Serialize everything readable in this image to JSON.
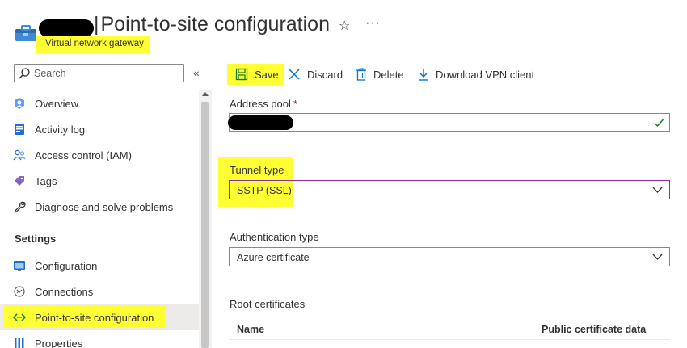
{
  "header": {
    "title": "Point-to-site configuration",
    "subtitle": "Virtual network gateway",
    "favorite_icon": "star-icon",
    "more_icon": "more-icon"
  },
  "sidebar": {
    "search_placeholder": "Search",
    "collapse_glyph": "«",
    "items_top": [
      {
        "label": "Overview",
        "icon": "overview-icon"
      },
      {
        "label": "Activity log",
        "icon": "activity-log-icon"
      },
      {
        "label": "Access control (IAM)",
        "icon": "iam-icon"
      },
      {
        "label": "Tags",
        "icon": "tag-icon"
      },
      {
        "label": "Diagnose and solve problems",
        "icon": "wrench-icon"
      }
    ],
    "section_settings": "Settings",
    "items_settings": [
      {
        "label": "Configuration",
        "icon": "configuration-icon"
      },
      {
        "label": "Connections",
        "icon": "connections-icon"
      },
      {
        "label": "Point-to-site configuration",
        "icon": "point-to-site-icon",
        "active": true
      },
      {
        "label": "Properties",
        "icon": "properties-icon"
      }
    ]
  },
  "toolbar": {
    "save": "Save",
    "discard": "Discard",
    "delete": "Delete",
    "download": "Download VPN client"
  },
  "form": {
    "address_pool_label": "Address pool",
    "required_mark": "*",
    "tunnel_type_label": "Tunnel type",
    "tunnel_type_value": "SSTP (SSL)",
    "auth_type_label": "Authentication type",
    "auth_type_value": "Azure certificate",
    "root_certificates_label": "Root certificates",
    "columns": [
      "Name",
      "Public certificate data"
    ]
  },
  "colors": {
    "highlight": "#ffff33",
    "accent_blue": "#0078d4",
    "focus_border": "#8a2da8",
    "valid_check": "#107c10"
  }
}
